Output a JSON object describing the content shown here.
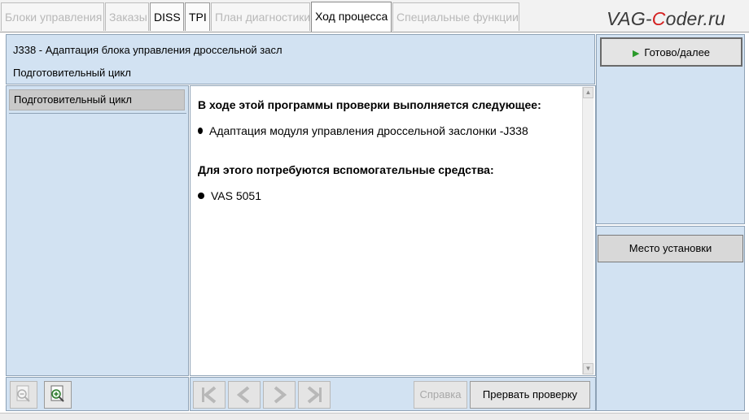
{
  "tabs": [
    {
      "label": "Блоки управления",
      "state": "disabled"
    },
    {
      "label": "Заказы",
      "state": "disabled"
    },
    {
      "label": "DISS",
      "state": "enabled"
    },
    {
      "label": "TPI",
      "state": "enabled"
    },
    {
      "label": "План диагностики",
      "state": "disabled"
    },
    {
      "label": "Ход процесса",
      "state": "active"
    },
    {
      "label": "Специальные функции",
      "state": "disabled"
    }
  ],
  "watermark": {
    "part1": "VAG-",
    "part2": "C",
    "part3": "oder.ru"
  },
  "header": {
    "title": "J338 - Адаптация блока управления дроссельной засл",
    "subtitle": "Подготовительный цикл"
  },
  "left_list": {
    "items": [
      {
        "label": "Подготовительный цикл",
        "selected": true
      }
    ]
  },
  "content": {
    "heading1": "В ходе этой программы проверки выполняется следующее:",
    "item1": "Адаптация модуля управления дроссельной заслонки -J338",
    "heading2": "Для этого потребуются вспомогательные средства:",
    "item2": "VAS 5051"
  },
  "right": {
    "next_button": "Готово/далее",
    "location_button": "Место установки"
  },
  "bottom_left": {
    "icons": [
      "zoom-out-icon",
      "zoom-in-icon"
    ]
  },
  "bottom_right": {
    "nav_icons": [
      "first-page-icon",
      "previous-icon",
      "next-icon",
      "last-page-icon"
    ],
    "help_button": "Справка",
    "abort_button": "Прервать проверку"
  },
  "colors": {
    "panel": "#d2e2f2",
    "accent_green": "#2a9a2a",
    "watermark_red": "#d42020"
  }
}
